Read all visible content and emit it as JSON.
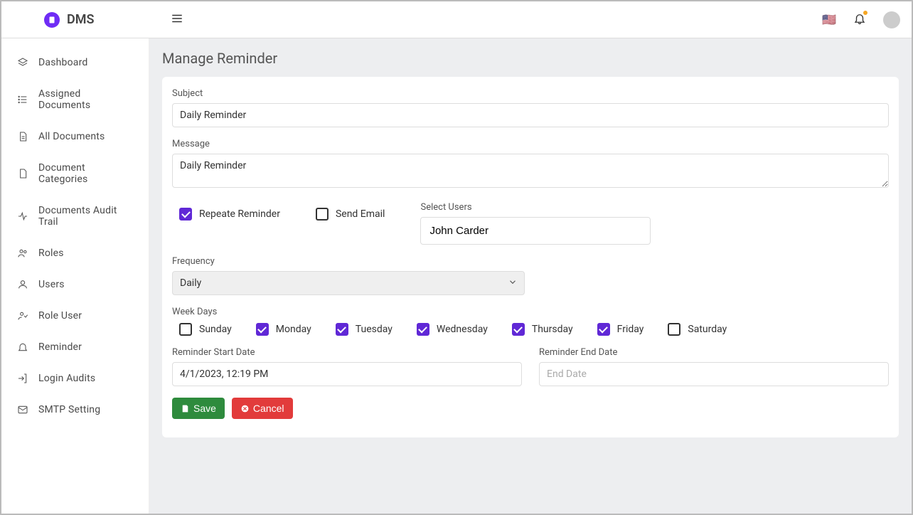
{
  "brand": {
    "name": "DMS"
  },
  "header": {
    "flag_emoji": "🇺🇸"
  },
  "sidebar": {
    "items": [
      {
        "label": "Dashboard"
      },
      {
        "label": "Assigned Documents"
      },
      {
        "label": "All Documents"
      },
      {
        "label": "Document Categories"
      },
      {
        "label": "Documents Audit Trail"
      },
      {
        "label": "Roles"
      },
      {
        "label": "Users"
      },
      {
        "label": "Role User"
      },
      {
        "label": "Reminder"
      },
      {
        "label": "Login Audits"
      },
      {
        "label": "SMTP Setting"
      }
    ]
  },
  "page": {
    "title": "Manage Reminder"
  },
  "form": {
    "subject_label": "Subject",
    "subject_value": "Daily Reminder",
    "message_label": "Message",
    "message_value": "Daily Reminder",
    "repeat_label": "Repeate Reminder",
    "repeat_checked": true,
    "send_email_label": "Send Email",
    "send_email_checked": false,
    "select_users_label": "Select Users",
    "selected_user": "John Carder",
    "frequency_label": "Frequency",
    "frequency_value": "Daily",
    "weekdays_label": "Week Days",
    "weekdays": [
      {
        "label": "Sunday",
        "checked": false
      },
      {
        "label": "Monday",
        "checked": true
      },
      {
        "label": "Tuesday",
        "checked": true
      },
      {
        "label": "Wednesday",
        "checked": true
      },
      {
        "label": "Thursday",
        "checked": true
      },
      {
        "label": "Friday",
        "checked": true
      },
      {
        "label": "Saturday",
        "checked": false
      }
    ],
    "start_label": "Reminder Start Date",
    "start_value": "4/1/2023, 12:19 PM",
    "end_label": "Reminder End Date",
    "end_placeholder": "End Date",
    "end_value": "",
    "save_label": "Save",
    "cancel_label": "Cancel"
  }
}
